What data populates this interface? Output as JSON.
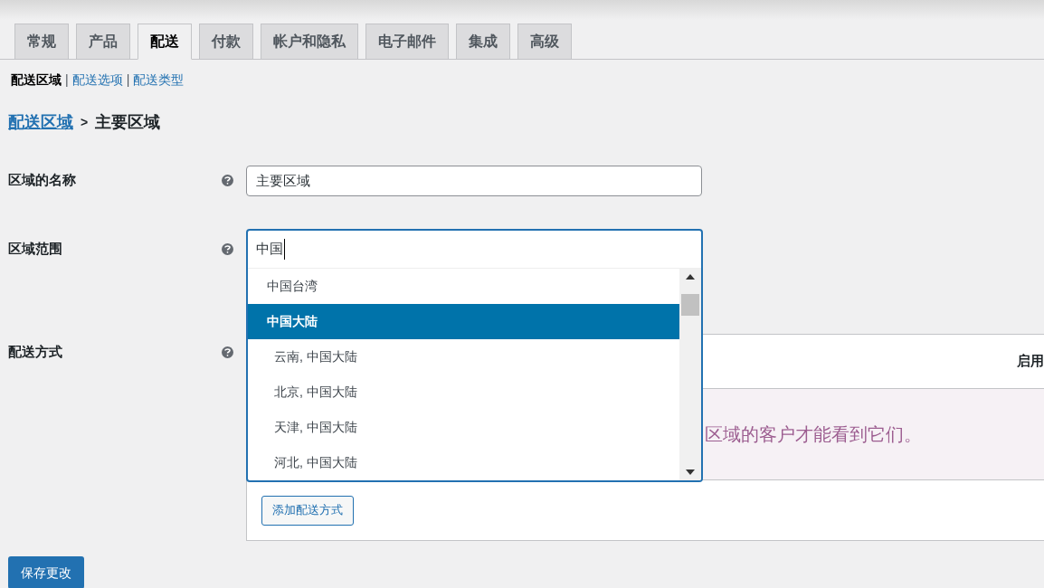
{
  "tabs": [
    {
      "label": "常规",
      "selected": false
    },
    {
      "label": "产品",
      "selected": false
    },
    {
      "label": "配送",
      "selected": true
    },
    {
      "label": "付款",
      "selected": false
    },
    {
      "label": "帐户和隐私",
      "selected": false
    },
    {
      "label": "电子邮件",
      "selected": false
    },
    {
      "label": "集成",
      "selected": false
    },
    {
      "label": "高级",
      "selected": false
    }
  ],
  "subnav_separator": "|",
  "subnav": [
    {
      "label": "配送区域",
      "selected": true
    },
    {
      "label": "配送选项",
      "selected": false
    },
    {
      "label": "配送类型",
      "selected": false
    }
  ],
  "breadcrumb": {
    "link": "配送区域",
    "separator": ">",
    "current": "主要区域"
  },
  "zone_name": {
    "label": "区域的名称",
    "value": "主要区域"
  },
  "zone_regions": {
    "label": "区域范围",
    "value": "中国",
    "options": [
      {
        "label": "中国台湾",
        "selected": false,
        "kind": "country"
      },
      {
        "label": "中国大陆",
        "selected": true,
        "kind": "country"
      },
      {
        "label": "云南, 中国大陆",
        "selected": false,
        "kind": "state"
      },
      {
        "label": "北京, 中国大陆",
        "selected": false,
        "kind": "state"
      },
      {
        "label": "天津, 中国大陆",
        "selected": false,
        "kind": "state"
      },
      {
        "label": "河北, 中国大陆",
        "selected": false,
        "kind": "state"
      }
    ]
  },
  "shipping_methods": {
    "label": "配送方式",
    "column_header": "启用",
    "notice": "区域的客户才能看到它们。",
    "add_button": "添加配送方式"
  },
  "save_button": "保存更改"
}
